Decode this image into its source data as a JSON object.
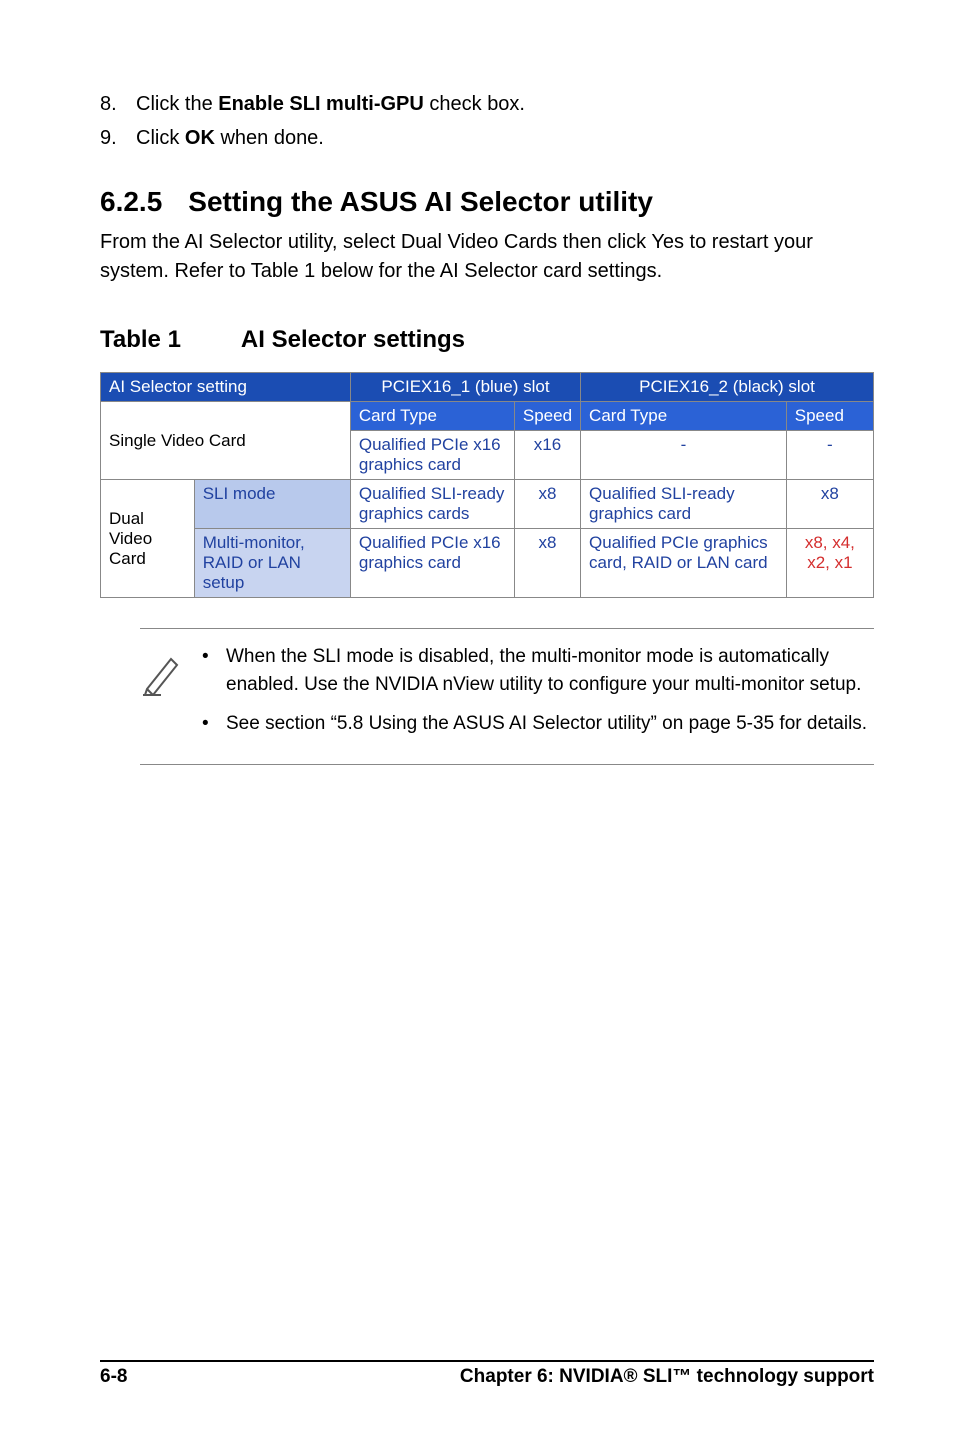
{
  "steps": {
    "s8": {
      "num": "8.",
      "pre": "Click the ",
      "bold": "Enable SLI multi-GPU",
      "post": " check box."
    },
    "s9": {
      "num": "9.",
      "pre": "Click ",
      "bold": "OK",
      "post": " when done."
    }
  },
  "section": {
    "num": "6.2.5",
    "title": "Setting the ASUS AI Selector utility",
    "body": "From the AI Selector utility, select Dual Video Cards then click Yes to restart your system. Refer to Table 1 below for the AI Selector card settings."
  },
  "table_heading": {
    "num": "Table 1",
    "title": "AI Selector settings"
  },
  "table": {
    "hdr1": {
      "a": "AI Selector setting",
      "b": "PCIEX16_1 (blue) slot",
      "c": "PCIEX16_2 (black) slot"
    },
    "hdr2": {
      "cardtype": "Card Type",
      "speed": "Speed"
    },
    "rows": {
      "single": {
        "label": "Single Video Card",
        "slot1_card": "Qualified PCIe x16 graphics card",
        "slot1_speed": "x16",
        "slot2_card": "-",
        "slot2_speed": "-"
      },
      "dual_label": "Dual Video Card",
      "dual_sli": {
        "mode": "SLI mode",
        "slot1_card": "Qualified SLI-ready graphics cards",
        "slot1_speed": "x8",
        "slot2_card": "Qualified SLI-ready graphics card",
        "slot2_speed": "x8"
      },
      "dual_multi": {
        "mode": "Multi-monitor, RAID or LAN setup",
        "slot1_card": "Qualified PCIe x16 graphics card",
        "slot1_speed": "x8",
        "slot2_card": "Qualified PCIe graphics card, RAID or LAN card",
        "slot2_speed": "x8, x4, x2, x1"
      }
    }
  },
  "notes": {
    "n1": "When the SLI mode is disabled, the multi-monitor mode is automatically enabled. Use the NVIDIA nView utility to configure your multi-monitor setup.",
    "n2": "See section “5.8 Using the ASUS AI Selector utility” on page 5-35 for details."
  },
  "footer": {
    "page": "6-8",
    "title": "Chapter 6: NVIDIA® SLI™ technology support"
  }
}
